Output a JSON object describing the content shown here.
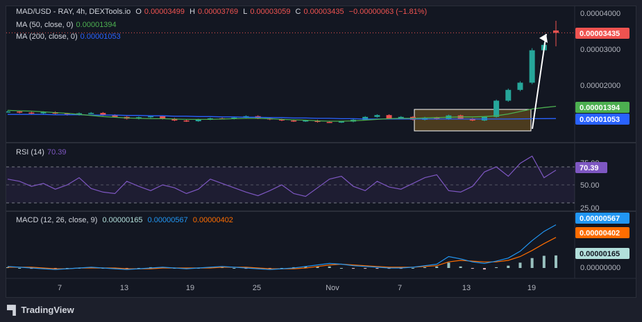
{
  "header": {
    "symbol": "MAD/USD - RAY, 4h, DEXTools.io",
    "o_label": "O",
    "o_val": "0.00003499",
    "h_label": "H",
    "h_val": "0.00003769",
    "l_label": "L",
    "l_val": "0.00003059",
    "c_label": "C",
    "c_val": "0.00003435",
    "change": "−0.00000063 (−1.81%)"
  },
  "ma50": {
    "label": "MA (50, close, 0)",
    "value": "0.00001394"
  },
  "ma200": {
    "label": "MA (200, close, 0)",
    "value": "0.00001053"
  },
  "rsi": {
    "label": "RSI (14)",
    "value": "70.39"
  },
  "macd": {
    "label": "MACD (12, 26, close, 9)",
    "hist": "0.00000165",
    "macd": "0.00000567",
    "signal": "0.00000402"
  },
  "price_axis": [
    "0.00004000",
    "0.00003000",
    "0.00002000"
  ],
  "rsi_axis": [
    "75.00",
    "50.00",
    "25.00"
  ],
  "macd_axis": [
    "0.00000000"
  ],
  "time_axis": [
    "7",
    "13",
    "19",
    "25",
    "Nov",
    "7",
    "13",
    "19"
  ],
  "badges": {
    "last_price": "0.00003435",
    "ma50": "0.00001394",
    "ma200": "0.00001053",
    "rsi": "70.39",
    "macd_line": "0.00000567",
    "macd_signal": "0.00000402",
    "macd_hist": "0.00000165"
  },
  "colors": {
    "up": "#26a69a",
    "down": "#ef5350",
    "ma50": "#4caf50",
    "ma200": "#2962ff",
    "rsi": "#7e57c2",
    "macd": "#2196f3",
    "signal": "#ff6d00",
    "bg": "#131722"
  },
  "chart_data": {
    "type": "candlestick",
    "timeframe": "4h",
    "last_price": 3.435e-05,
    "open": 3.499e-05,
    "high": 3.769e-05,
    "low": 3.059e-05,
    "close": 3.435e-05,
    "close_series_approx": [
      1.25e-05,
      1.22e-05,
      1.2e-05,
      1.23e-05,
      1.19e-05,
      1.16e-05,
      1.2e-05,
      1.21e-05,
      1.15e-05,
      1.1e-05,
      1.05e-05,
      1.09e-05,
      1.12e-05,
      1.05e-05,
      1e-05,
      9.8e-06,
      1.03e-05,
      1.06e-05,
      1.05e-05,
      1.08e-05,
      1.12e-05,
      1.06e-05,
      1.03e-05,
      1e-05,
      9.8e-06,
      1e-05,
      9.6e-06,
      9.5e-06,
      9.7e-06,
      1.02e-05,
      1.1e-05,
      1.15e-05,
      1.05e-05,
      1.1e-05,
      1.02e-05,
      1.08e-05,
      1.04e-05,
      1.14e-05,
      1.05e-05,
      1e-05,
      1.1e-05,
      1.55e-05,
      1.85e-05,
      2.05e-05,
      2.95e-05,
      3.1e-05,
      3.435e-05
    ],
    "ma50_series_approx": [
      1.28e-05,
      1.27e-05,
      1.26e-05,
      1.24e-05,
      1.22e-05,
      1.2e-05,
      1.17e-05,
      1.14e-05,
      1.11e-05,
      1.09e-05,
      1.07e-05,
      1.06e-05,
      1.05e-05,
      1.05e-05,
      1.04e-05,
      1.03e-05,
      1.03e-05,
      1.03e-05,
      1.04e-05,
      1.05e-05,
      1.06e-05,
      1.06e-05,
      1.05e-05,
      1.03e-05,
      1.02e-05,
      1.01e-05,
      9.9e-06,
      9.8e-06,
      9.8e-06,
      9.9e-06,
      1.01e-05,
      1.03e-05,
      1.05e-05,
      1.06e-05,
      1.06e-05,
      1.07e-05,
      1.08e-05,
      1.09e-05,
      1.1e-05,
      1.1e-05,
      1.11e-05,
      1.13e-05,
      1.18e-05,
      1.25e-05,
      1.32e-05,
      1.36e-05,
      1.394e-05
    ],
    "ma200_series_approx": [
      1.17e-05,
      1.17e-05,
      1.17e-05,
      1.17e-05,
      1.16e-05,
      1.16e-05,
      1.16e-05,
      1.15e-05,
      1.15e-05,
      1.15e-05,
      1.14e-05,
      1.14e-05,
      1.13e-05,
      1.13e-05,
      1.12e-05,
      1.12e-05,
      1.11e-05,
      1.11e-05,
      1.1e-05,
      1.1e-05,
      1.09e-05,
      1.09e-05,
      1.08e-05,
      1.08e-05,
      1.07e-05,
      1.07e-05,
      1.06e-05,
      1.06e-05,
      1.05e-05,
      1.05e-05,
      1.04e-05,
      1.04e-05,
      1.04e-05,
      1.04e-05,
      1.04e-05,
      1.04e-05,
      1.04e-05,
      1.04e-05,
      1.04e-05,
      1.04e-05,
      1.04e-05,
      1.04e-05,
      1.04e-05,
      1.045e-05,
      1.05e-05,
      1.052e-05,
      1.053e-05
    ],
    "rsi_series_approx": [
      58,
      55,
      48,
      52,
      44,
      50,
      60,
      45,
      40,
      38,
      55,
      48,
      42,
      50,
      46,
      38,
      44,
      58,
      52,
      46,
      40,
      35,
      42,
      50,
      38,
      34,
      46,
      58,
      62,
      48,
      42,
      55,
      47,
      44,
      52,
      60,
      64,
      42,
      40,
      48,
      68,
      75,
      62,
      80,
      90,
      60,
      70.39
    ],
    "macd_series_approx": [
      2e-07,
      1e-07,
      0.0,
      -1e-07,
      -2e-07,
      -1e-07,
      0.0,
      1e-07,
      0.0,
      -1e-07,
      -2e-07,
      -1e-07,
      0.0,
      1e-07,
      0.0,
      -1e-07,
      0.0,
      1e-07,
      2e-07,
      1e-07,
      0.0,
      -1e-07,
      -2e-07,
      -1e-07,
      0.0,
      2e-07,
      4e-07,
      6e-07,
      5e-07,
      3e-07,
      2e-07,
      1e-07,
      0.0,
      0.0,
      1e-07,
      3e-07,
      5e-07,
      1.5e-06,
      1.2e-06,
      8e-07,
      6e-07,
      9e-07,
      1.3e-06,
      2.2e-06,
      3.6e-06,
      4.8e-06,
      5.67e-06
    ],
    "signal_series_approx": [
      1e-07,
      1e-07,
      1e-07,
      0.0,
      -1e-07,
      -1e-07,
      0.0,
      0.0,
      0.0,
      0.0,
      -1e-07,
      -1e-07,
      -1e-07,
      0.0,
      0.0,
      0.0,
      0.0,
      0.0,
      1e-07,
      1e-07,
      1e-07,
      0.0,
      -1e-07,
      -1e-07,
      -1e-07,
      0.0,
      2e-07,
      4e-07,
      5e-07,
      4e-07,
      3e-07,
      2e-07,
      1e-07,
      1e-07,
      1e-07,
      2e-07,
      3e-07,
      8e-07,
      1e-06,
      9e-07,
      8e-07,
      8e-07,
      1e-06,
      1.5e-06,
      2.3e-06,
      3.2e-06,
      4.02e-06
    ],
    "ylim": [
      8e-06,
      4.1e-05
    ],
    "rsi_levels": [
      75,
      50,
      25
    ]
  }
}
